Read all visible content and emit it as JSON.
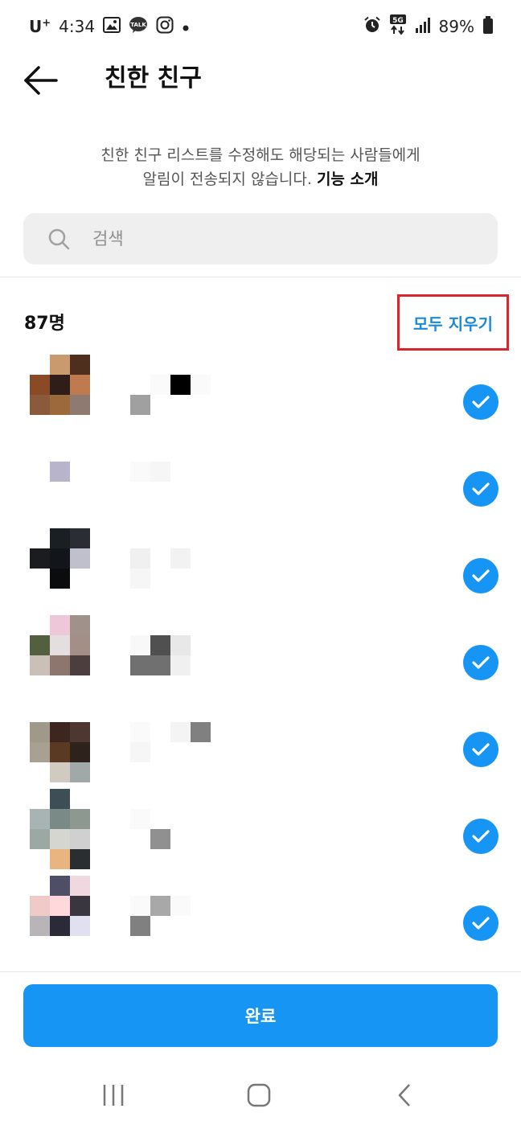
{
  "status_bar": {
    "carrier": "U",
    "carrier_sup": "+",
    "time": "4:34",
    "battery": "89%",
    "network": "5G",
    "left_icons": [
      "gallery-icon",
      "kakaotalk-icon",
      "instagram-icon",
      "dot-icon"
    ],
    "right_icons": [
      "alarm-icon",
      "5g-icon",
      "signal-icon",
      "battery-icon"
    ]
  },
  "header": {
    "title": "친한 친구",
    "back_icon": "arrow-left-icon"
  },
  "description": {
    "line1": "친한 친구 리스트를 수정해도 해당되는 사람들에게",
    "line2": "알림이 전송되지 않습니다.",
    "link": "기능 소개"
  },
  "search": {
    "placeholder": "검색",
    "value": ""
  },
  "list": {
    "count_label": "87명",
    "clear_all": "모두 지우기",
    "friends": [
      {
        "selected": true
      },
      {
        "selected": true
      },
      {
        "selected": true
      },
      {
        "selected": true
      },
      {
        "selected": true
      },
      {
        "selected": true
      },
      {
        "selected": true
      }
    ]
  },
  "done_button": "완료",
  "colors": {
    "accent": "#1795f5",
    "link": "#1a8ad6",
    "highlight_box": "#d9262e"
  },
  "nav_bar": {
    "icons": [
      "recent-apps-icon",
      "home-icon",
      "back-icon"
    ]
  }
}
